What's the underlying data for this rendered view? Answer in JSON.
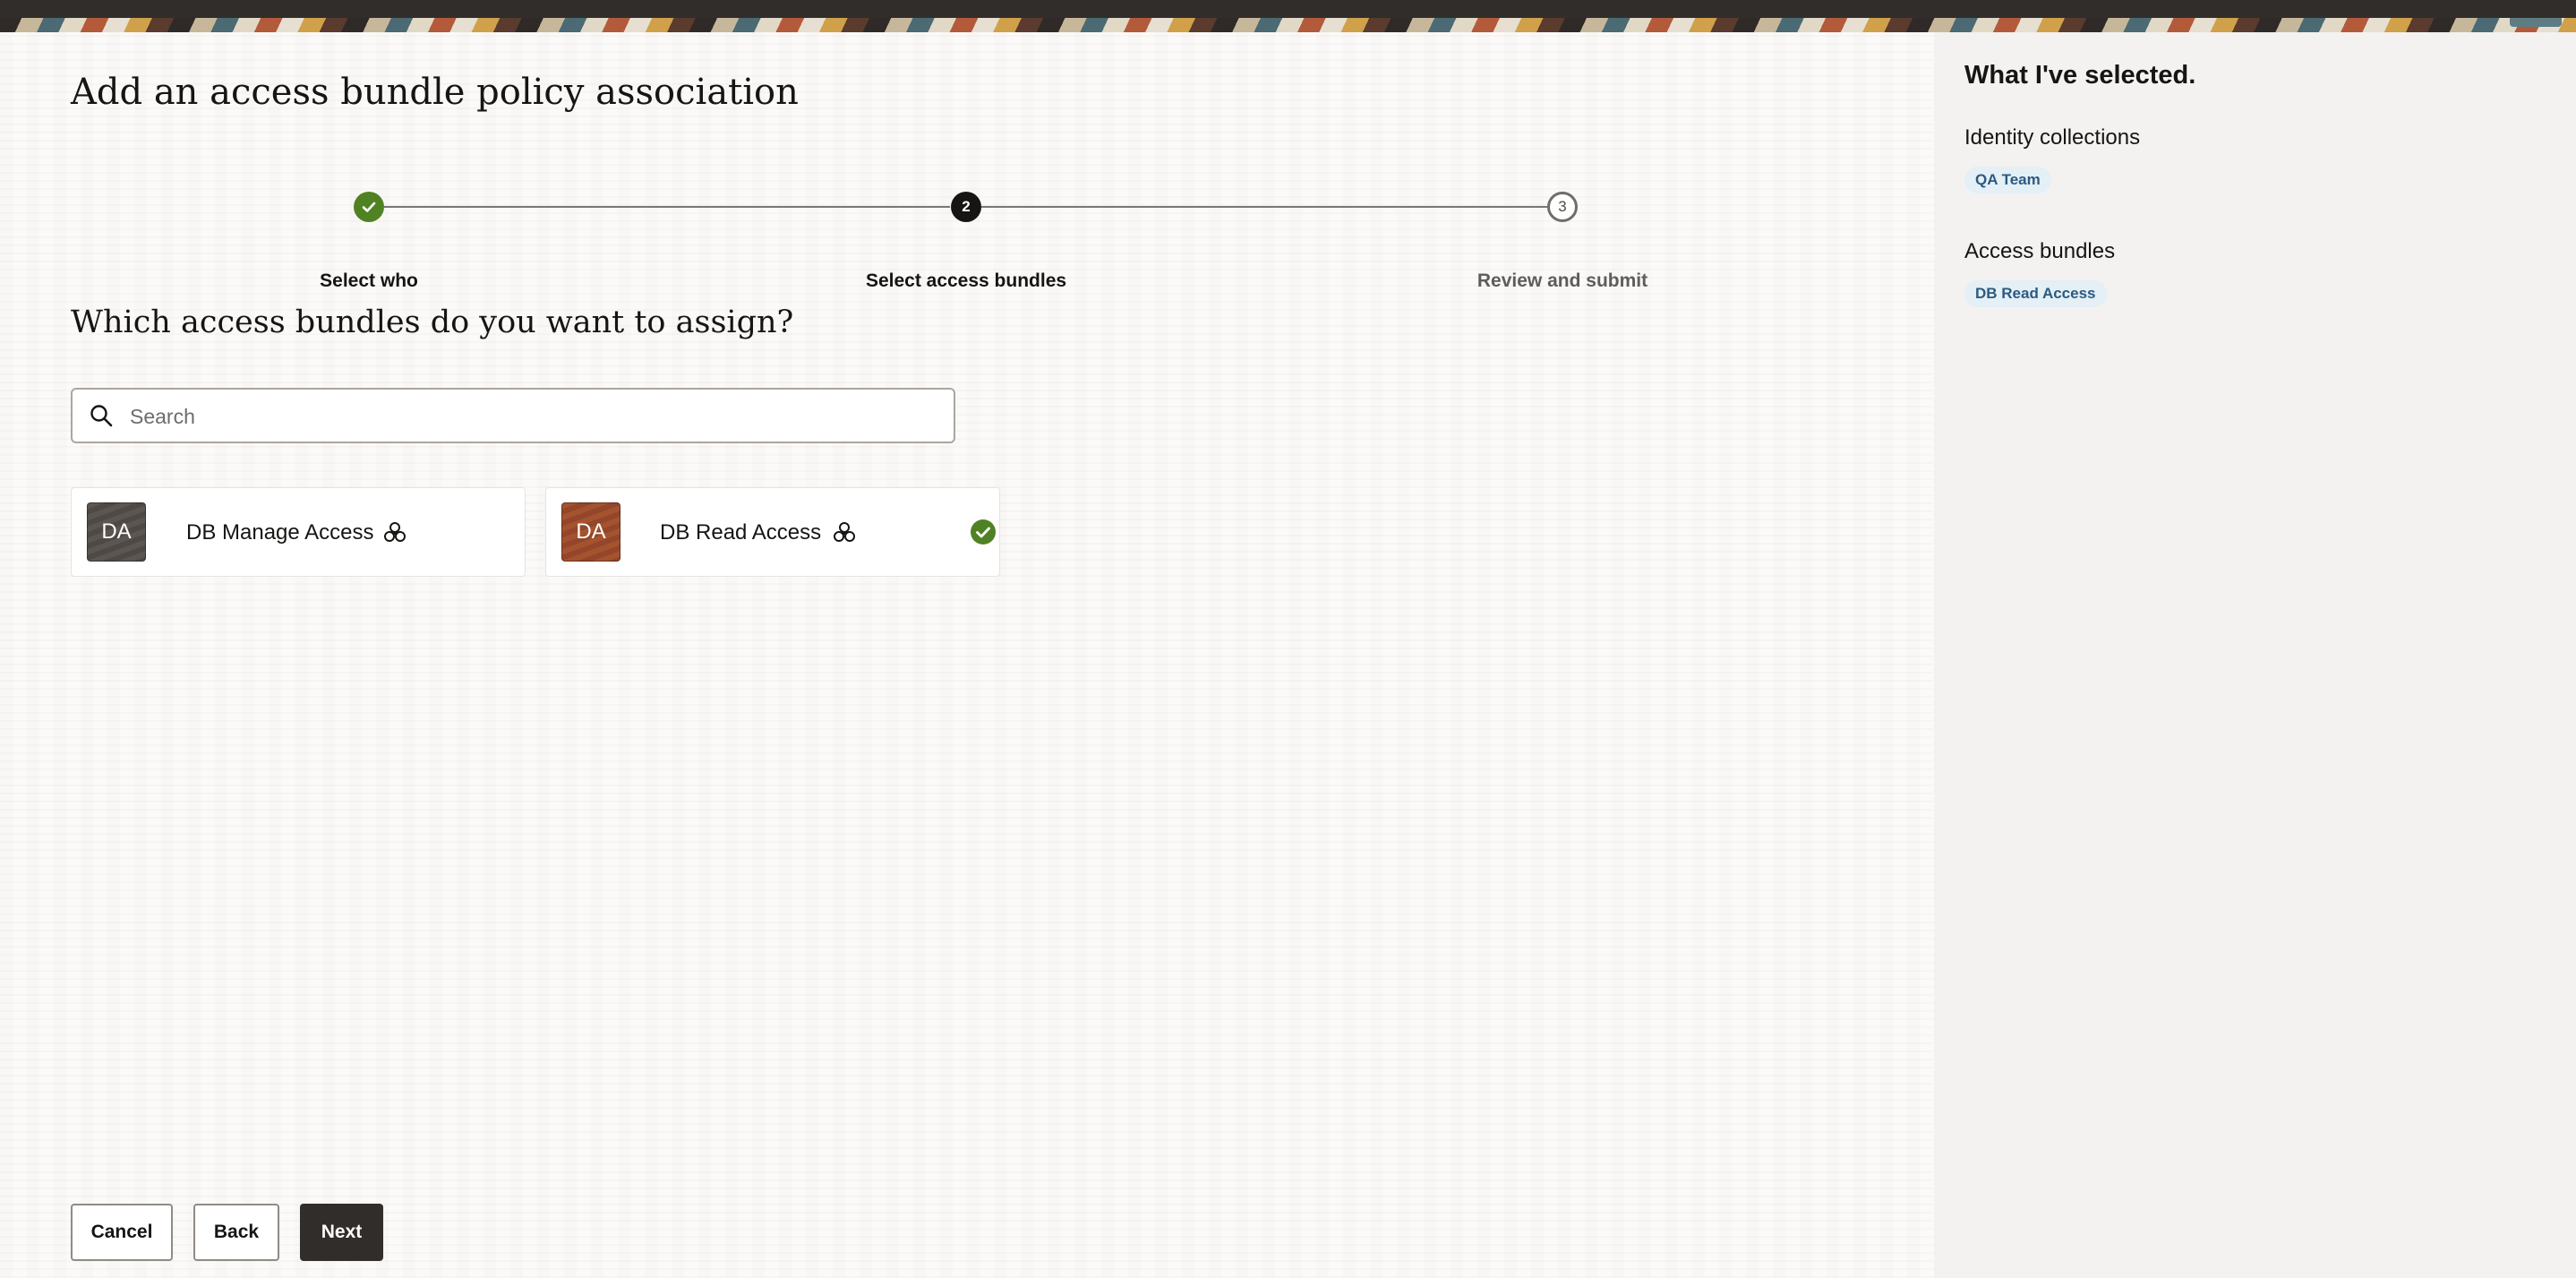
{
  "page": {
    "title": "Add an access bundle policy association",
    "question": "Which access bundles do you want to assign?"
  },
  "steps": [
    {
      "number": "1",
      "label": "Select who",
      "status": "completed"
    },
    {
      "number": "2",
      "label": "Select access bundles",
      "status": "current"
    },
    {
      "number": "3",
      "label": "Review and submit",
      "status": "upcoming"
    }
  ],
  "search": {
    "placeholder": "Search",
    "value": ""
  },
  "bundles": [
    {
      "initials": "DA",
      "name": "DB Manage Access",
      "selected": false
    },
    {
      "initials": "DA",
      "name": "DB Read Access",
      "selected": true
    }
  ],
  "buttons": {
    "cancel": "Cancel",
    "back": "Back",
    "next": "Next"
  },
  "summary": {
    "title": "What I've selected.",
    "identity_heading": "Identity collections",
    "identity_items": [
      "QA Team"
    ],
    "bundles_heading": "Access bundles",
    "bundle_items": [
      "DB Read Access"
    ]
  },
  "icons": {
    "search": "search-icon",
    "bundle": "access-bundle-icon",
    "check": "check-circle-icon"
  },
  "colors": {
    "success": "#508223",
    "primary_button": "#312d2a",
    "chip_bg": "#e4eff6",
    "chip_text": "#2b5a80"
  }
}
